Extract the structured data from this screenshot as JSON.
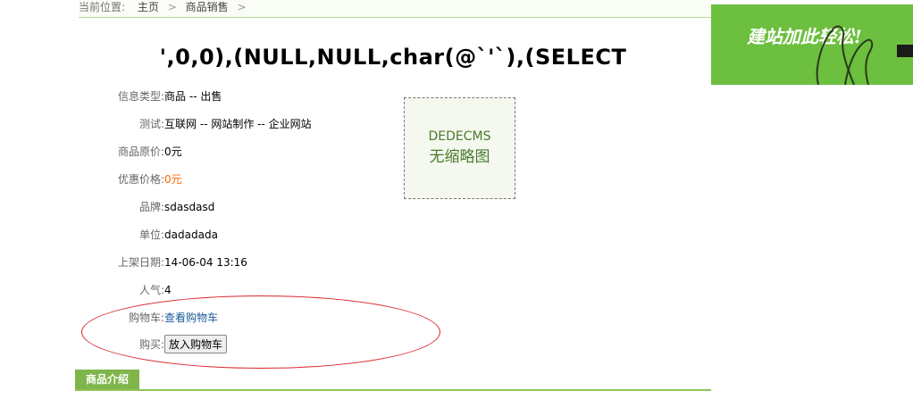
{
  "breadcrumb": {
    "prefix": "当前位置:",
    "items": [
      "主页",
      "商品销售"
    ],
    "sep": ">"
  },
  "title": "',0,0),(NULL,NULL,char(@`'`),(SELECT",
  "details": [
    {
      "key": "信息类型",
      "value": "商品 -- 出售"
    },
    {
      "key": "测试",
      "value": "互联网 -- 网站制作 -- 企业网站"
    },
    {
      "key": "商品原价",
      "value": "0元"
    },
    {
      "key": "优惠价格",
      "value": "0元",
      "highlight": "#ff6600"
    },
    {
      "key": "品牌",
      "value": "sdasdasd"
    },
    {
      "key": "单位",
      "value": "dadadada"
    },
    {
      "key": "上架日期",
      "value": "14-06-04 13:16"
    },
    {
      "key": "人气",
      "value": "4"
    }
  ],
  "cart": {
    "key": "购物车",
    "link": "查看购物车"
  },
  "buy": {
    "key": "购买",
    "button": "放入购物车"
  },
  "thumb": {
    "line1": "DEDECMS",
    "line2": "无缩略图"
  },
  "section_tab": "商品介绍",
  "banner": {
    "text": "建站加此轻松!"
  }
}
